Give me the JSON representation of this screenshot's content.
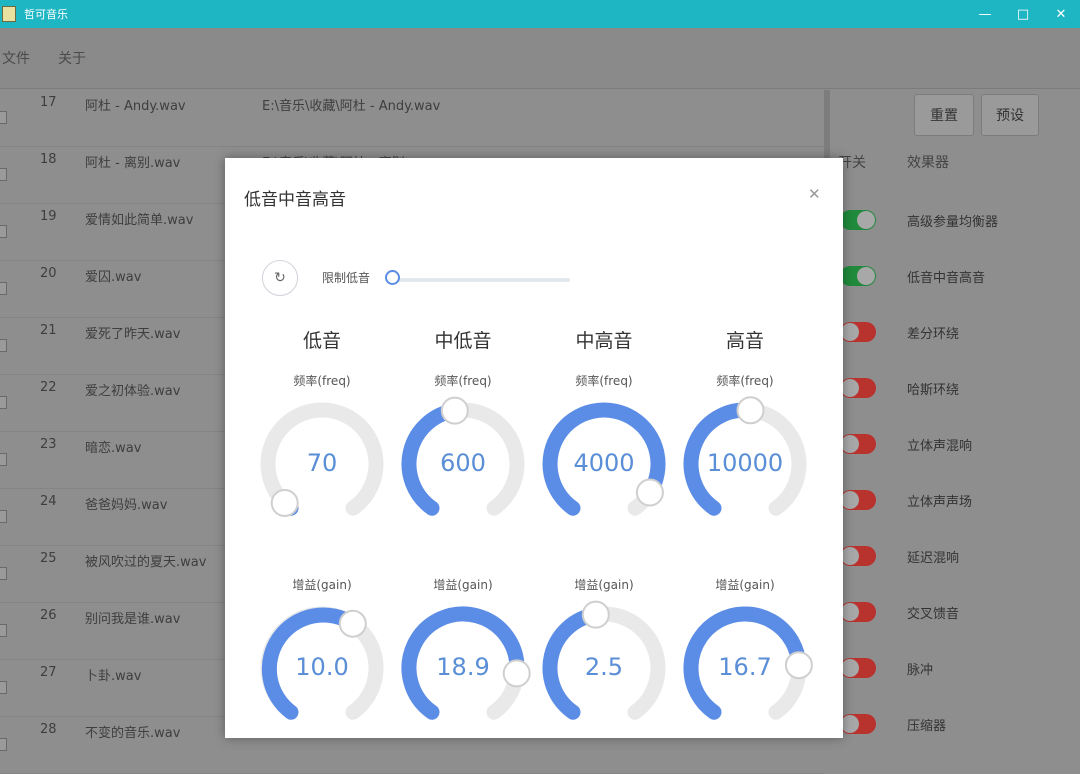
{
  "window": {
    "title": "哲可音乐",
    "controls": [
      "—",
      "□",
      "✕"
    ]
  },
  "menu": [
    "文件",
    "关于"
  ],
  "list": {
    "rows": [
      {
        "num": "17",
        "name": "阿杜 - Andy.wav",
        "path": "E:\\音乐\\收藏\\阿杜 - Andy.wav"
      },
      {
        "num": "18",
        "name": "阿杜 - 离别.wav",
        "path": "E:\\音乐\\收藏\\阿杜 - 离别.wav"
      },
      {
        "num": "19",
        "name": "爱情如此简单.wav",
        "path": ""
      },
      {
        "num": "20",
        "name": "爱囚.wav",
        "path": ""
      },
      {
        "num": "21",
        "name": "爱死了昨天.wav",
        "path": ""
      },
      {
        "num": "22",
        "name": "爱之初体验.wav",
        "path": ""
      },
      {
        "num": "23",
        "name": "暗恋.wav",
        "path": ""
      },
      {
        "num": "24",
        "name": "爸爸妈妈.wav",
        "path": ""
      },
      {
        "num": "25",
        "name": "被风吹过的夏天.wav",
        "path": ""
      },
      {
        "num": "26",
        "name": "别问我是谁.wav",
        "path": ""
      },
      {
        "num": "27",
        "name": "卜卦.wav",
        "path": ""
      },
      {
        "num": "28",
        "name": "不变的音乐.wav",
        "path": ""
      }
    ]
  },
  "right_panel": {
    "reset_label": "重置",
    "preset_label": "预设",
    "header_switch": "开关",
    "header_effect": "效果器",
    "effects": [
      {
        "name": "高级参量均衡器",
        "on": true
      },
      {
        "name": "低音中音高音",
        "on": true
      },
      {
        "name": "差分环绕",
        "on": false
      },
      {
        "name": "哈斯环绕",
        "on": false
      },
      {
        "name": "立体声混响",
        "on": false
      },
      {
        "name": "立体声声场",
        "on": false
      },
      {
        "name": "延迟混响",
        "on": false
      },
      {
        "name": "交叉馈音",
        "on": false
      },
      {
        "name": "脉冲",
        "on": false
      },
      {
        "name": "压缩器",
        "on": false
      }
    ],
    "colors": {
      "on": "#1f8a3c",
      "off": "#b8322e"
    }
  },
  "modal": {
    "title": "低音中音高音",
    "close_icon": "close-icon",
    "reset_icon": "refresh-icon",
    "slider_label": "限制低音",
    "slider_value": 0,
    "accent": "#5b8de6",
    "freq_label": "频率(freq)",
    "gain_label": "增益(gain)",
    "bands": [
      {
        "name": "低音",
        "freq": "70",
        "freq_frac": 0.03,
        "gain": "10.0",
        "gain_frac": 0.62
      },
      {
        "name": "中低音",
        "freq": "600",
        "freq_frac": 0.47,
        "gain": "18.9",
        "gain_frac": 0.83
      },
      {
        "name": "中高音",
        "freq": "4000",
        "freq_frac": 0.92,
        "gain": "2.5",
        "gain_frac": 0.47
      },
      {
        "name": "高音",
        "freq": "10000",
        "freq_frac": 0.52,
        "gain": "16.7",
        "gain_frac": 0.8
      }
    ]
  }
}
